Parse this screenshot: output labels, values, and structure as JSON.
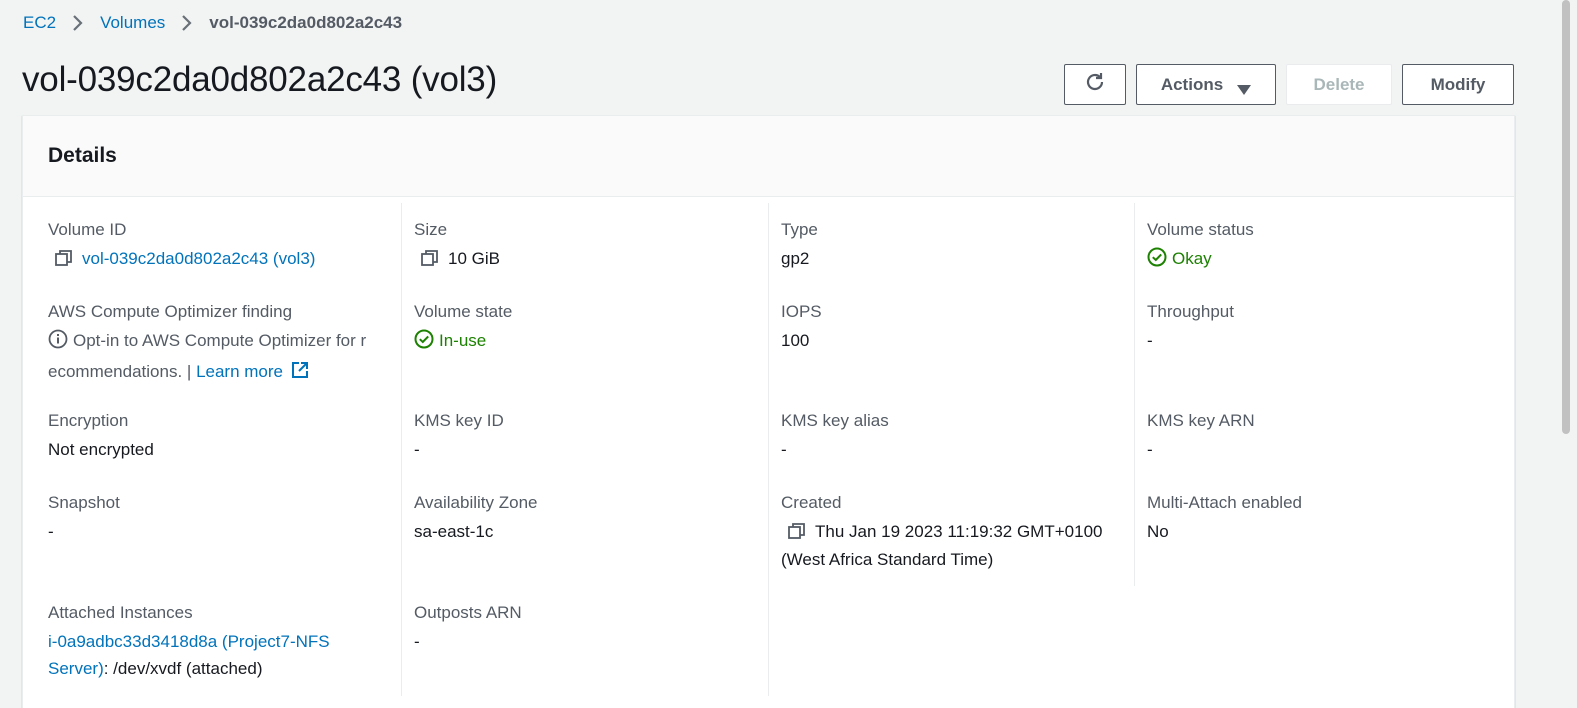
{
  "breadcrumb": {
    "items": [
      "EC2",
      "Volumes"
    ],
    "current": "vol-039c2da0d802a2c43"
  },
  "header": {
    "title": "vol-039c2da0d802a2c43 (vol3)",
    "actions_label": "Actions",
    "delete_label": "Delete",
    "modify_label": "Modify"
  },
  "details": {
    "heading": "Details",
    "volume_id": {
      "label": "Volume ID",
      "value": "vol-039c2da0d802a2c43 (vol3)"
    },
    "size": {
      "label": "Size",
      "value": "10 GiB"
    },
    "type": {
      "label": "Type",
      "value": "gp2"
    },
    "volume_status": {
      "label": "Volume status",
      "value": "Okay"
    },
    "optimizer": {
      "label": "AWS Compute Optimizer finding",
      "text": "Opt-in to AWS Compute Optimizer for r",
      "text2": "ecommendations. |",
      "link": "Learn more"
    },
    "volume_state": {
      "label": "Volume state",
      "value": "In-use"
    },
    "iops": {
      "label": "IOPS",
      "value": "100"
    },
    "throughput": {
      "label": "Throughput",
      "value": "-"
    },
    "encryption": {
      "label": "Encryption",
      "value": "Not encrypted"
    },
    "kms_key_id": {
      "label": "KMS key ID",
      "value": "-"
    },
    "kms_key_alias": {
      "label": "KMS key alias",
      "value": "-"
    },
    "kms_key_arn": {
      "label": "KMS key ARN",
      "value": "-"
    },
    "snapshot": {
      "label": "Snapshot",
      "value": "-"
    },
    "availability_zone": {
      "label": "Availability Zone",
      "value": "sa-east-1c"
    },
    "created": {
      "label": "Created",
      "value_line1": "Thu Jan 19 2023 11:19:32 GMT+0100",
      "value_line2": "(West Africa Standard Time)"
    },
    "multi_attach": {
      "label": "Multi-Attach enabled",
      "value": "No"
    },
    "attached_instances": {
      "label": "Attached Instances",
      "link_line1": "i-0a9adbc33d3418d8a (Project7-NFS",
      "link_line2": "Server)",
      "suffix": ": /dev/xvdf (attached)"
    },
    "outposts_arn": {
      "label": "Outposts ARN",
      "value": "-"
    }
  },
  "colors": {
    "link": "#0073bb",
    "success": "#1d8102",
    "text": "#16191f",
    "label": "#545b64",
    "background": "#f2f3f3"
  },
  "icons": [
    "chevron-right-icon",
    "refresh-icon",
    "caret-down-icon",
    "copy-icon",
    "check-circle-icon",
    "info-icon",
    "external-link-icon"
  ]
}
